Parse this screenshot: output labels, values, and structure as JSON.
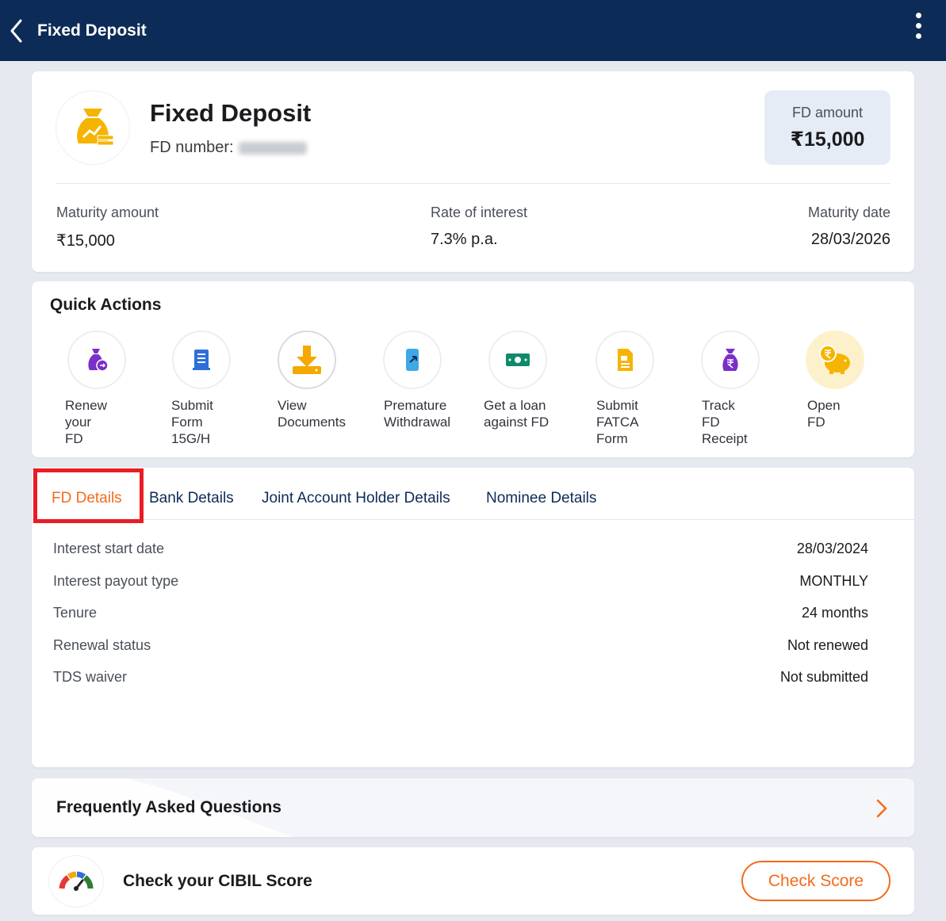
{
  "header": {
    "title": "Fixed Deposit",
    "back_icon": "chevron-left-icon",
    "menu_icon": "kebab-menu-icon"
  },
  "summary": {
    "title": "Fixed Deposit",
    "fd_number_label": "FD number:",
    "fd_amount_label": "FD amount",
    "fd_amount_value": "₹15,000",
    "maturity_amount_label": "Maturity amount",
    "maturity_amount_value": "₹15,000",
    "rate_label": "Rate of interest",
    "rate_value": "7.3% p.a.",
    "maturity_date_label": "Maturity date",
    "maturity_date_value": "28/03/2026"
  },
  "quick_actions": {
    "title": "Quick Actions",
    "items": [
      {
        "label": "Renew\nyour\nFD",
        "icon": "renew-bag-icon"
      },
      {
        "label": "Submit\nForm\n15G/H",
        "icon": "form-document-icon"
      },
      {
        "label": "View\nDocuments",
        "icon": "download-icon"
      },
      {
        "label": "Premature\nWithdrawal",
        "icon": "withdrawal-phone-icon"
      },
      {
        "label": "Get a loan\nagainst FD",
        "icon": "cash-note-icon"
      },
      {
        "label": "Submit\nFATCA\nForm",
        "icon": "fatca-document-icon"
      },
      {
        "label": "Track\nFD\nReceipt",
        "icon": "rupee-bag-icon"
      },
      {
        "label": "Open\nFD",
        "icon": "piggy-bank-icon"
      }
    ]
  },
  "tabs": [
    {
      "label": "FD Details",
      "active": true
    },
    {
      "label": "Bank Details"
    },
    {
      "label": "Joint Account Holder Details"
    },
    {
      "label": "Nominee Details"
    }
  ],
  "fd_details": [
    {
      "key": "Interest start date",
      "value": "28/03/2024"
    },
    {
      "key": "Interest payout type",
      "value": "MONTHLY"
    },
    {
      "key": "Tenure",
      "value": "24 months"
    },
    {
      "key": "Renewal status",
      "value": "Not renewed"
    },
    {
      "key": "TDS waiver",
      "value": "Not submitted"
    }
  ],
  "faq": {
    "title": "Frequently Asked Questions"
  },
  "cibil": {
    "text": "Check your CIBIL Score",
    "button": "Check Score"
  },
  "colors": {
    "header_bg": "#0d2b57",
    "accent": "#f26b1d",
    "highlight_box": "#ea1c24",
    "page_bg": "#e6eaf0"
  }
}
